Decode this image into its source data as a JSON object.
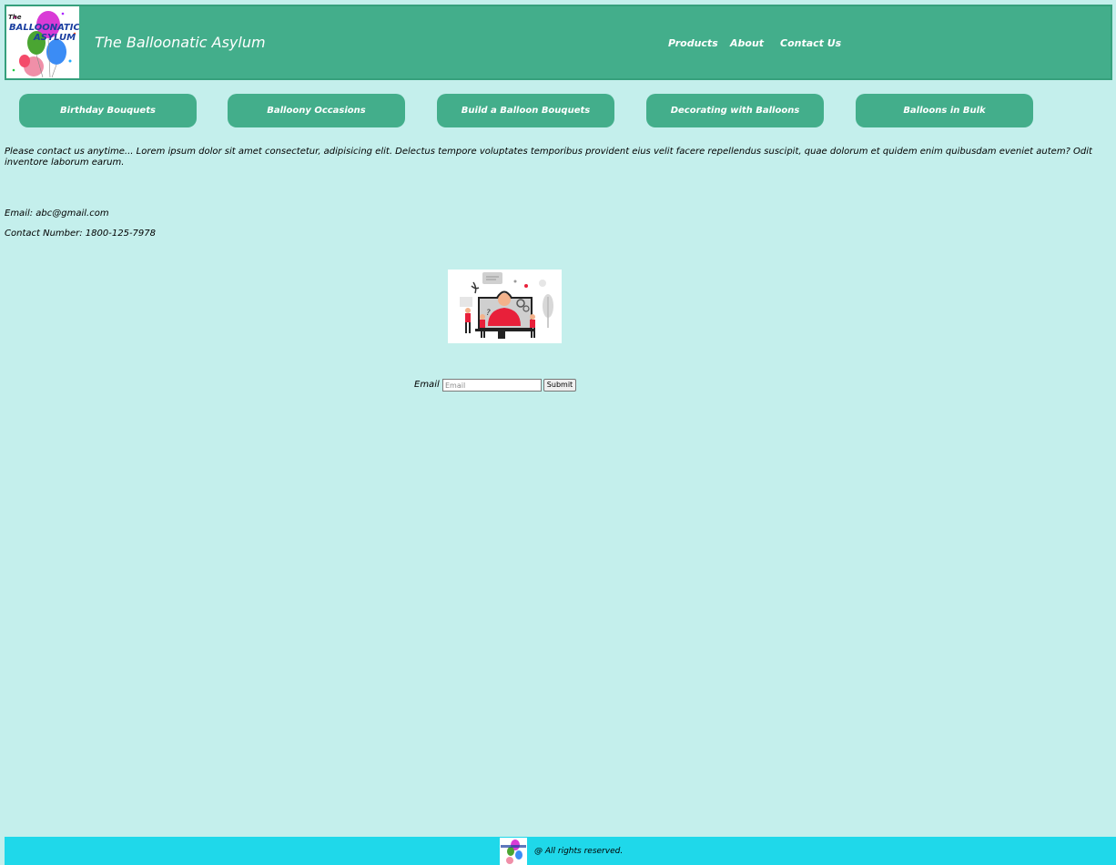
{
  "header": {
    "logo_text": "The BALLOONATIC ASYLUM",
    "title": "The Balloonatic Asylum",
    "nav": [
      "Products",
      "About",
      "Contact Us"
    ]
  },
  "categories": [
    "Birthday Bouquets",
    "Balloony Occasions",
    "Build a Balloon Bouquets",
    "Decorating with Balloons",
    "Balloons in Bulk"
  ],
  "contact": {
    "intro": "Please contact us anytime... Lorem ipsum dolor sit amet consectetur, adipisicing elit. Delectus tempore voluptates temporibus provident eius velit facere repellendus suscipit, quae dolorum et quidem enim quibusdam eveniet autem? Odit inventore laborum earum.",
    "email": "Email: abc@gmail.com",
    "phone": "Contact Number: 1800-125-7978"
  },
  "form": {
    "label": "Email",
    "placeholder": "Email",
    "submit": "Submit"
  },
  "footer": {
    "text": "@ All rights reserved."
  },
  "colors": {
    "background": "#c4efec",
    "header": "#43ae8b",
    "button": "#43ae8b",
    "footer": "#1fd8ea"
  }
}
